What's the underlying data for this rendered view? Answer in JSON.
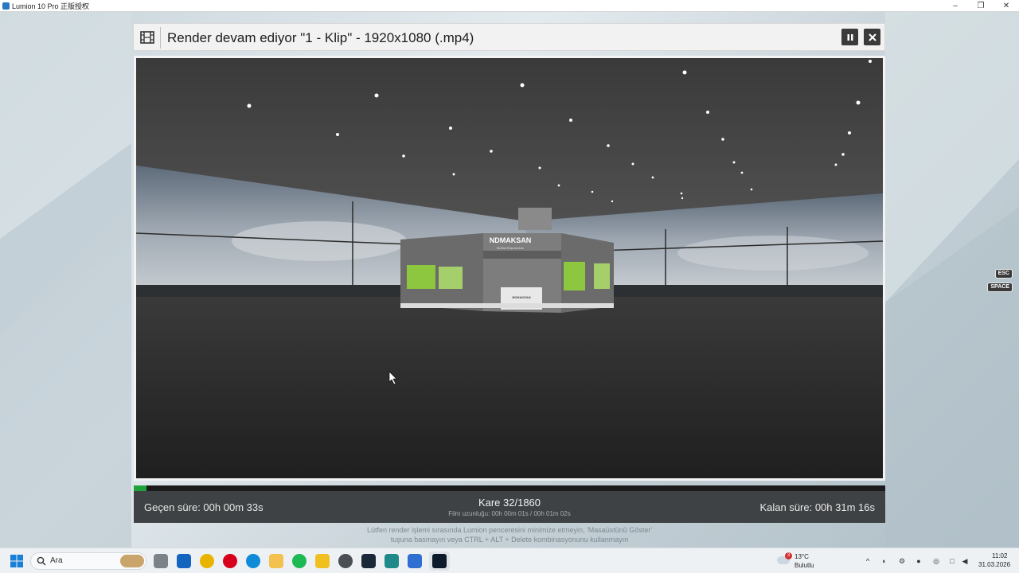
{
  "window": {
    "title": "Lumion 10 Pro 正版授权"
  },
  "render": {
    "title": "Render devam ediyor \"1 - Klip\" - 1920x1080 (.mp4)",
    "progress_fraction": 0.0172
  },
  "scene": {
    "booth_brand": "NDMAKSAN",
    "booth_subtitle": "Mutfak Ekipmanları",
    "counter_brand": "NDMAKSAN"
  },
  "stats": {
    "elapsed": "Geçen süre: 00h 00m 33s",
    "frame": "Kare 32/1860",
    "film_length": "Film uzunluğu: 00h 00m 01s / 00h 01m 02s",
    "remaining": "Kalan süre: 00h 31m 16s"
  },
  "notice": {
    "line1": "Lütfen render işlemi sırasında Lumion penceresini minimize etmeyin, 'Masaüstünü Göster'",
    "line2": "tuşuna basmayın veya CTRL + ALT + Delete kombinasyonunu kullanmayın"
  },
  "key_hints": {
    "esc": "ESC",
    "space": "SPACE"
  },
  "taskbar": {
    "search_label": "Ara",
    "weather_temp": "13°C",
    "weather_desc": "Bulutlu",
    "weather_badge": "3",
    "time": "11:02",
    "date": "31.03.2026"
  },
  "colors": {
    "progress": "#1fa33a",
    "stats_bg": "#3e4244",
    "header_bg": "#f2f2f2",
    "booth_green": "#8dc63f"
  },
  "icons": [
    "film-icon",
    "pause-icon",
    "close-icon",
    "windows-start-icon",
    "search-icon",
    "weather-icon"
  ]
}
